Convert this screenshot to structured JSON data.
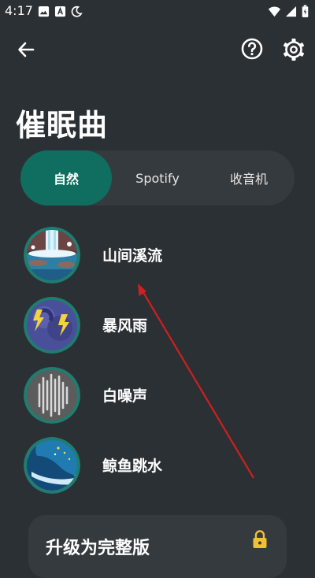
{
  "status_bar": {
    "time": "4:17",
    "left_icons": [
      "image-icon",
      "a-icon",
      "moon-icon"
    ],
    "right_icons": [
      "wifi-icon",
      "signal-icon",
      "battery-icon"
    ]
  },
  "header": {
    "title": "催眠曲",
    "back_icon": "arrow-left-icon",
    "help_icon": "help-icon",
    "settings_icon": "gear-icon"
  },
  "tabs": [
    {
      "label": "自然",
      "active": true
    },
    {
      "label": "Spotify",
      "active": false
    },
    {
      "label": "收音机",
      "active": false
    }
  ],
  "sounds": [
    {
      "label": "山间溪流",
      "icon": "waterfall-icon"
    },
    {
      "label": "暴风雨",
      "icon": "storm-icon"
    },
    {
      "label": "白噪声",
      "icon": "white-noise-icon"
    },
    {
      "label": "鲸鱼跳水",
      "icon": "whale-icon"
    }
  ],
  "upgrade": {
    "title": "升级为完整版",
    "icon": "lock-icon"
  },
  "colors": {
    "background": "#2b3034",
    "accent": "#0f6e60",
    "surface": "#343a3e",
    "annotation_arrow": "#d21f1f"
  }
}
